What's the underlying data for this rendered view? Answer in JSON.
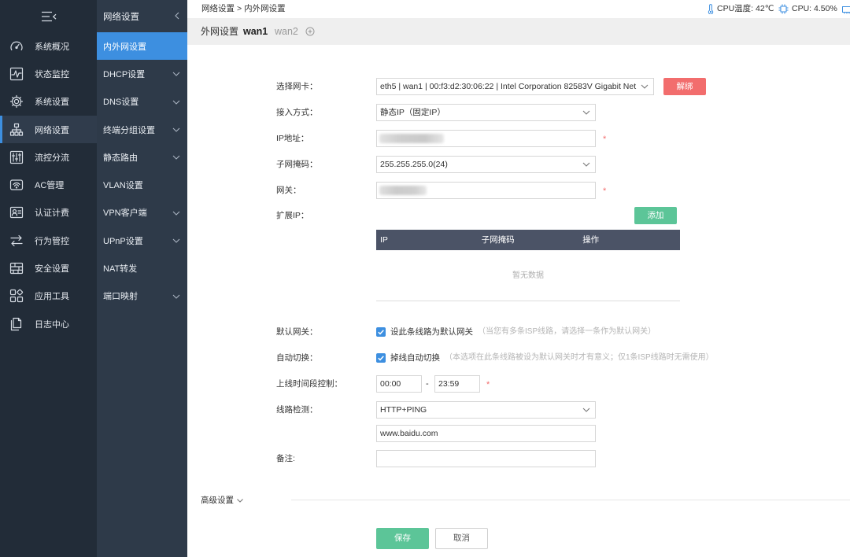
{
  "sidebar": {
    "toggle_icon": "menu-collapse-icon",
    "active_index": 3,
    "items": [
      {
        "label": "系统概况",
        "icon": "dashboard-icon"
      },
      {
        "label": "状态监控",
        "icon": "activity-monitor-icon"
      },
      {
        "label": "系统设置",
        "icon": "gear-icon"
      },
      {
        "label": "网络设置",
        "icon": "network-topology-icon"
      },
      {
        "label": "流控分流",
        "icon": "sliders-icon"
      },
      {
        "label": "AC管理",
        "icon": "wifi-access-point-icon"
      },
      {
        "label": "认证计费",
        "icon": "id-card-icon"
      },
      {
        "label": "行为管控",
        "icon": "arrows-swap-icon"
      },
      {
        "label": "安全设置",
        "icon": "firewall-icon"
      },
      {
        "label": "应用工具",
        "icon": "apps-icon"
      },
      {
        "label": "日志中心",
        "icon": "documents-icon"
      }
    ]
  },
  "subnav": {
    "title": "网络设置",
    "collapse_icon": "chevron-left-icon",
    "active_index": 0,
    "items": [
      {
        "label": "内外网设置",
        "expandable": false
      },
      {
        "label": "DHCP设置",
        "expandable": true
      },
      {
        "label": "DNS设置",
        "expandable": true
      },
      {
        "label": "终端分组设置",
        "expandable": true
      },
      {
        "label": "静态路由",
        "expandable": true
      },
      {
        "label": "VLAN设置",
        "expandable": false
      },
      {
        "label": "VPN客户端",
        "expandable": true
      },
      {
        "label": "UPnP设置",
        "expandable": true
      },
      {
        "label": "NAT转发",
        "expandable": false
      },
      {
        "label": "端口映射",
        "expandable": true
      }
    ]
  },
  "topbar": {
    "breadcrumb": {
      "parent": "网络设置",
      "separator": ">",
      "current": "内外网设置"
    },
    "cpu_temperature": {
      "icon": "thermometer-icon",
      "text": "CPU温度: 42℃"
    },
    "cpu_usage": {
      "icon": "cpu-chip-icon",
      "text": "CPU: 4.50%"
    },
    "trailing_icon": "memory-icon"
  },
  "tabs": {
    "section_label": "外网设置",
    "items": [
      {
        "label": "wan1",
        "active": true
      },
      {
        "label": "wan2",
        "active": false
      }
    ],
    "add_icon": "add-circle-icon"
  },
  "form": {
    "required_mark": "*",
    "nic": {
      "label": "选择网卡：",
      "value": "eth5 | wan1 | 00:f3:d2:30:06:22 | Intel Corporation 82583V Gigabit Net",
      "unbind_button": "解绑"
    },
    "access_mode": {
      "label": "接入方式：",
      "value": "静态IP（固定IP）"
    },
    "ip_address": {
      "label": "IP地址：",
      "required": true,
      "value_masked": true
    },
    "subnet_mask": {
      "label": "子网掩码：",
      "value": "255.255.255.0(24)"
    },
    "gateway": {
      "label": "网关：",
      "required": true,
      "value_masked": true
    },
    "extended_ip": {
      "label": "扩展IP：",
      "add_button": "添加",
      "columns": [
        "IP",
        "子网掩码",
        "操作"
      ],
      "rows": [],
      "empty_text": "暂无数据"
    },
    "default_gateway": {
      "label": "默认网关：",
      "checkbox_label": "设此条线路为默认网关",
      "checked": true,
      "hint": "（当您有多条ISP线路，请选择一条作为默认网关）"
    },
    "auto_switch": {
      "label": "自动切换：",
      "checkbox_label": "掉线自动切换",
      "checked": true,
      "hint": "（本选项在此条线路被设为默认网关时才有意义；仅1条ISP线路时无需使用）"
    },
    "online_time": {
      "label": "上线时间段控制：",
      "start": "00:00",
      "separator": "-",
      "end": "23:59",
      "required": true
    },
    "line_detection": {
      "label": "线路检测：",
      "method": "HTTP+PING",
      "target": "www.baidu.com"
    },
    "remark": {
      "label": "备注:",
      "value": ""
    },
    "advanced": {
      "label": "高级设置",
      "expanded": false
    }
  },
  "actions": {
    "save": "保存",
    "cancel": "取消"
  },
  "colors": {
    "accent": "#3d8fe0",
    "success": "#5cc598",
    "danger": "#f26d6d",
    "sidebar_bg": "#222c38",
    "subnav_bg": "#2e3a49",
    "table_header_bg": "#4b5366"
  }
}
